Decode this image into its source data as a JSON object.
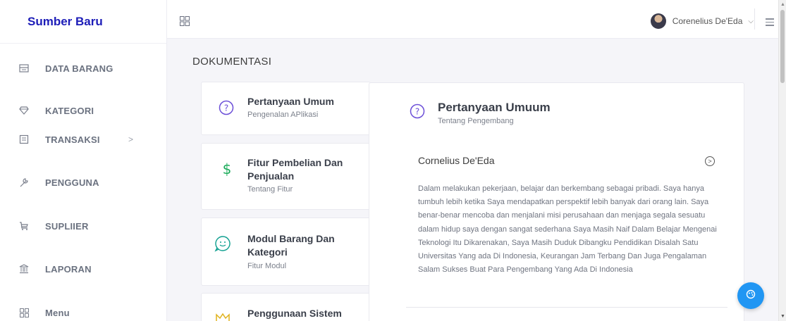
{
  "brand": {
    "name": "Sumber Baru"
  },
  "sidebar": {
    "items": [
      {
        "label": "DATA BARANG",
        "icon": "inbox-icon"
      },
      {
        "label": "KATEGORI",
        "icon": "diamond-icon"
      },
      {
        "label": "TRANSAKSI",
        "icon": "receipt-icon",
        "chevron": ">"
      },
      {
        "label": "PENGGUNA",
        "icon": "wrench-icon"
      },
      {
        "label": "SUPLIIER",
        "icon": "cart-icon"
      },
      {
        "label": "LAPORAN",
        "icon": "bank-icon"
      },
      {
        "label": "Menu",
        "icon": "grid-icon"
      }
    ]
  },
  "header": {
    "user_name": "Corenelius De'Eda",
    "user_chevron": "⌵"
  },
  "main": {
    "page_title": "DOKUMENTASI",
    "cards": [
      {
        "title": "Pertanyaan Umum",
        "subtitle": "Pengenalan APlikasi",
        "icon": "question-circle-icon"
      },
      {
        "title": "Fitur Pembelian Dan Penjualan",
        "subtitle": "Tentang Fitur",
        "icon": "dollar-icon"
      },
      {
        "title": "Modul Barang Dan Kategori",
        "subtitle": "Fitur Modul",
        "icon": "smile-icon"
      },
      {
        "title": "Penggunaan Sistem",
        "subtitle": "",
        "icon": "crown-icon"
      }
    ],
    "detail": {
      "title": "Pertanyaan Umuum",
      "subtitle": "Tentang Pengembang",
      "accordion_title": "Cornelius De'Eda",
      "accordion_toggle": ">",
      "accordion_body": "Dalam melakukan pekerjaan, belajar dan berkembang sebagai pribadi. Saya hanya tumbuh lebih ketika Saya mendapatkan perspektif lebih banyak dari orang lain. Saya benar-benar mencoba dan menjalani misi perusahaan dan menjaga segala sesuatu dalam hidup saya dengan sangat sederhana Saya Masih Naif Dalam Belajar Mengenai Teknologi Itu Dikarenakan, Saya Masih Duduk Dibangku Pendidikan Disalah Satu Universitas Yang ada Di Indonesia, Keurangan Jam Terbang Dan Juga Pengalaman Salam Sukses Buat Para Pengembang Yang Ada Di Indonesia"
    }
  },
  "colors": {
    "brand": "#1d1db8",
    "accent": "#2196f3",
    "question_icon": "#6c4fd8",
    "dollar_icon": "#1bab5a",
    "smile_icon": "#0e9f8f",
    "crown_icon": "#e0b21c"
  }
}
